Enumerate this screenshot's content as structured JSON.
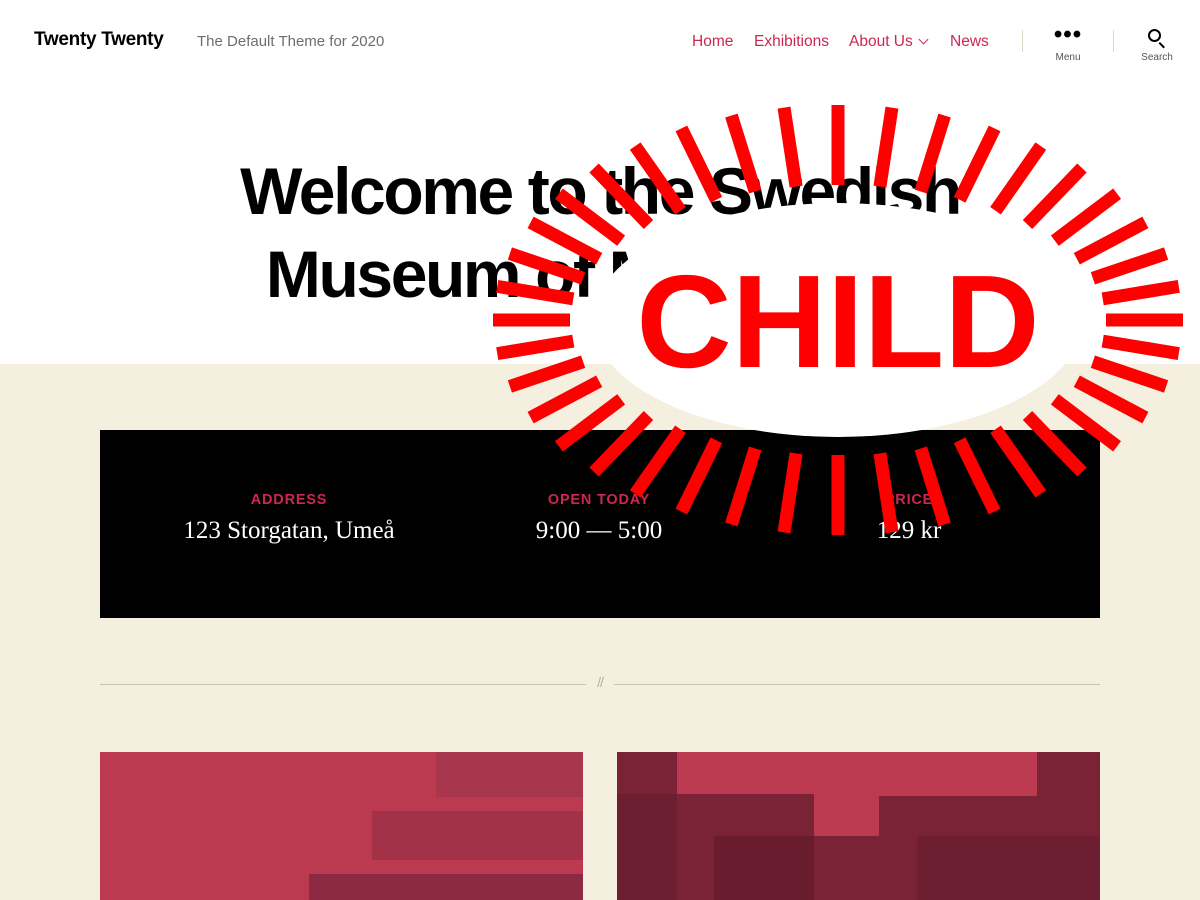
{
  "header": {
    "site_title": "Twenty Twenty",
    "site_description": "The Default Theme for 2020",
    "nav": [
      "Home",
      "Exhibitions",
      "About Us",
      "News"
    ],
    "menu_label": "Menu",
    "search_label": "Search"
  },
  "hero": {
    "title_line1": "Welcome to the Swedish",
    "title_line2": "Museum of Modern Art"
  },
  "info": [
    {
      "label": "ADDRESS",
      "value": "123 Storgatan, Umeå"
    },
    {
      "label": "OPEN TODAY",
      "value": "9:00 — 5:00"
    },
    {
      "label": "PRICE",
      "value": "129 kr"
    }
  ],
  "separator": "//",
  "sticker": {
    "text": "CHILD",
    "color": "#ff0000"
  },
  "colors": {
    "accent": "#cd2653",
    "beige": "#f5efe0",
    "card_red": "#bc3a50",
    "card_dark": "#7a2236"
  }
}
